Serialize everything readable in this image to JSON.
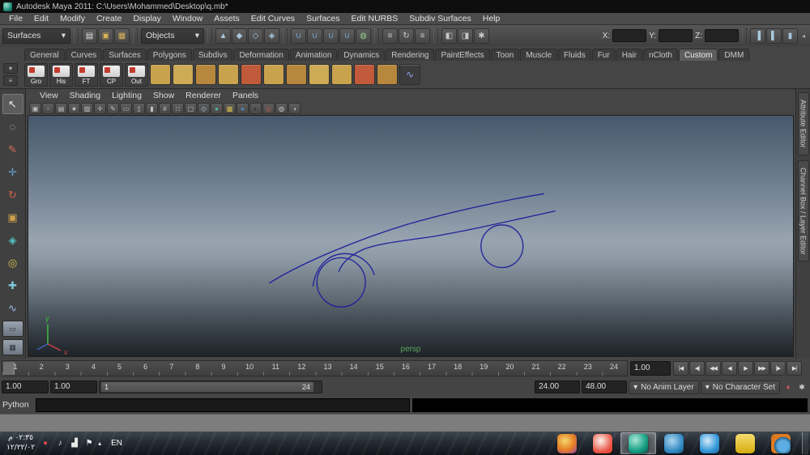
{
  "window": {
    "title": "Autodesk Maya 2011: C:\\Users\\Mohammed\\Desktop\\q.mb*"
  },
  "ui": {
    "dropdown_arrow": "▾",
    "up_arrow": "▴",
    "collapse_arrow": "◂"
  },
  "menubar": {
    "items": [
      {
        "name": "menu-file",
        "label": "File"
      },
      {
        "name": "menu-edit",
        "label": "Edit"
      },
      {
        "name": "menu-modify",
        "label": "Modify"
      },
      {
        "name": "menu-create",
        "label": "Create"
      },
      {
        "name": "menu-display",
        "label": "Display"
      },
      {
        "name": "menu-window",
        "label": "Window"
      },
      {
        "name": "menu-assets",
        "label": "Assets"
      },
      {
        "name": "menu-edit-curves",
        "label": "Edit Curves"
      },
      {
        "name": "menu-surfaces",
        "label": "Surfaces"
      },
      {
        "name": "menu-edit-nurbs",
        "label": "Edit NURBS"
      },
      {
        "name": "menu-subdiv-surfaces",
        "label": "Subdiv Surfaces"
      },
      {
        "name": "menu-help",
        "label": "Help"
      }
    ]
  },
  "statusline": {
    "menuset": "Surfaces",
    "selection_mask": "Objects",
    "x_label": "X:",
    "y_label": "Y:",
    "z_label": "Z:",
    "x_value": "",
    "y_value": "",
    "z_value": "",
    "file_icons": [
      {
        "name": "new-scene-icon",
        "glyph": "▤",
        "color": "#e2e2e2"
      },
      {
        "name": "open-scene-icon",
        "glyph": "▣",
        "color": "#d9b45a"
      },
      {
        "name": "save-scene-icon",
        "glyph": "▦",
        "color": "#d9b45a"
      }
    ],
    "selection_icons": [
      {
        "name": "select-by-hierarchy-icon",
        "glyph": "▲",
        "color": "#a9c6da"
      },
      {
        "name": "select-by-object-icon",
        "glyph": "◆",
        "color": "#a9c6da"
      },
      {
        "name": "select-by-component-icon",
        "glyph": "◇",
        "color": "#a9c6da"
      },
      {
        "name": "select-by-asset-icon",
        "glyph": "◈",
        "color": "#a9c6da"
      }
    ],
    "snap_icons": [
      {
        "name": "snap-to-grids-icon",
        "glyph": "∪",
        "color": "#74a9dd"
      },
      {
        "name": "snap-to-curves-icon",
        "glyph": "∪",
        "color": "#74a9dd"
      },
      {
        "name": "snap-to-points-icon",
        "glyph": "∪",
        "color": "#74a9dd"
      },
      {
        "name": "snap-to-view-planes-icon",
        "glyph": "∪",
        "color": "#74a9dd"
      },
      {
        "name": "make-live-icon",
        "glyph": "◍",
        "color": "#8fce8f"
      }
    ],
    "history_icons": [
      {
        "name": "input-to-selected-icon",
        "glyph": "≡",
        "color": "#cccccc"
      },
      {
        "name": "construction-history-icon",
        "glyph": "↻",
        "color": "#cccccc"
      },
      {
        "name": "output-from-selected-icon",
        "glyph": "≡",
        "color": "#cccccc"
      }
    ],
    "render_icons": [
      {
        "name": "render-current-frame-icon",
        "glyph": "◧",
        "color": "#c8c8c8"
      },
      {
        "name": "ipr-render-icon",
        "glyph": "◨",
        "color": "#c8c8c8"
      },
      {
        "name": "render-settings-icon",
        "glyph": "✱",
        "color": "#c8c8c8"
      }
    ],
    "sidebar_icons": [
      {
        "name": "show-attribute-editor-icon",
        "glyph": "▐",
        "color": "#a9c6da"
      },
      {
        "name": "show-tool-settings-icon",
        "glyph": "▌",
        "color": "#a9c6da"
      },
      {
        "name": "show-channel-box-icon",
        "glyph": "▮",
        "color": "#a9c6da"
      }
    ]
  },
  "shelf": {
    "side_buttons": [
      {
        "name": "shelf-tab-switcher-button",
        "glyph": "▾"
      },
      {
        "name": "shelf-menu-button",
        "glyph": "≡"
      }
    ],
    "tabs": [
      {
        "name": "shelf-tab-general",
        "label": "General"
      },
      {
        "name": "shelf-tab-curves",
        "label": "Curves"
      },
      {
        "name": "shelf-tab-surfaces",
        "label": "Surfaces"
      },
      {
        "name": "shelf-tab-polygons",
        "label": "Polygons"
      },
      {
        "name": "shelf-tab-subdivs",
        "label": "Subdivs"
      },
      {
        "name": "shelf-tab-deformation",
        "label": "Deformation"
      },
      {
        "name": "shelf-tab-animation",
        "label": "Animation"
      },
      {
        "name": "shelf-tab-dynamics",
        "label": "Dynamics"
      },
      {
        "name": "shelf-tab-rendering",
        "label": "Rendering"
      },
      {
        "name": "shelf-tab-painteffects",
        "label": "PaintEffects"
      },
      {
        "name": "shelf-tab-toon",
        "label": "Toon"
      },
      {
        "name": "shelf-tab-muscle",
        "label": "Muscle"
      },
      {
        "name": "shelf-tab-fluids",
        "label": "Fluids"
      },
      {
        "name": "shelf-tab-fur",
        "label": "Fur"
      },
      {
        "name": "shelf-tab-hair",
        "label": "Hair"
      },
      {
        "name": "shelf-tab-ncloth",
        "label": "nCloth"
      },
      {
        "name": "shelf-tab-custom",
        "label": "Custom",
        "active": true
      },
      {
        "name": "shelf-tab-dmm",
        "label": "DMM"
      }
    ],
    "labeled_items": [
      {
        "name": "shelf-item-gro",
        "label": "Gro"
      },
      {
        "name": "shelf-item-his",
        "label": "His"
      },
      {
        "name": "shelf-item-ft",
        "label": "FT"
      },
      {
        "name": "shelf-item-cp",
        "label": "CP"
      },
      {
        "name": "shelf-item-out",
        "label": "Out"
      }
    ],
    "icon_items": [
      {
        "name": "shelf-item-6",
        "bg": "#c9a24e"
      },
      {
        "name": "shelf-item-7",
        "bg": "#cdaa56"
      },
      {
        "name": "shelf-item-8",
        "bg": "#b8873e"
      },
      {
        "name": "shelf-item-9",
        "bg": "#c9a24e"
      },
      {
        "name": "shelf-item-10",
        "bg": "#c05a3a"
      },
      {
        "name": "shelf-item-11",
        "bg": "#c9a24e"
      },
      {
        "name": "shelf-item-12",
        "bg": "#b8873e"
      },
      {
        "name": "shelf-item-13",
        "bg": "#cdaa56"
      },
      {
        "name": "shelf-item-14",
        "bg": "#c9a24e"
      },
      {
        "name": "shelf-item-15",
        "bg": "#c05a3a"
      },
      {
        "name": "shelf-item-16",
        "bg": "#b8873e"
      },
      {
        "name": "shelf-item-17",
        "glyph": "∿",
        "color": "#8fa8e8",
        "bg": "#3c3c3c"
      }
    ]
  },
  "toolbox": {
    "tools": [
      {
        "name": "select-tool",
        "glyph": "↖",
        "color": "#e8e8e8",
        "active": true
      },
      {
        "name": "lasso-tool",
        "glyph": "◌",
        "color": "#e0b9b9"
      },
      {
        "name": "paint-selection-tool",
        "glyph": "✎",
        "color": "#d06a55"
      },
      {
        "name": "move-tool",
        "glyph": "✛",
        "color": "#6aa2d8"
      },
      {
        "name": "rotate-tool",
        "glyph": "↻",
        "color": "#d0604d"
      },
      {
        "name": "scale-tool",
        "glyph": "▣",
        "color": "#d0a24d"
      },
      {
        "name": "universal-manipulator-tool",
        "glyph": "◈",
        "color": "#54c2c2"
      },
      {
        "name": "soft-modification-tool",
        "glyph": "◎",
        "color": "#d8c455"
      },
      {
        "name": "show-manipulator-tool",
        "glyph": "✚",
        "color": "#7fc8d8"
      },
      {
        "name": "last-tool-used",
        "glyph": "∿",
        "color": "#9fb4e8"
      }
    ],
    "layout_buttons": [
      {
        "name": "single-pane-layout-button",
        "glyph": "▭"
      },
      {
        "name": "four-pane-layout-button",
        "glyph": "▦"
      }
    ]
  },
  "panel": {
    "menus": [
      {
        "name": "panel-menu-view",
        "label": "View"
      },
      {
        "name": "panel-menu-shading",
        "label": "Shading"
      },
      {
        "name": "panel-menu-lighting",
        "label": "Lighting"
      },
      {
        "name": "panel-menu-show",
        "label": "Show"
      },
      {
        "name": "panel-menu-renderer",
        "label": "Renderer"
      },
      {
        "name": "panel-menu-panels",
        "label": "Panels"
      }
    ],
    "toolbar_icons": [
      {
        "name": "select-camera-icon",
        "glyph": "▣"
      },
      {
        "name": "lock-camera-icon",
        "glyph": "▫"
      },
      {
        "name": "camera-attributes-icon",
        "glyph": "▤"
      },
      {
        "name": "bookmarks-icon",
        "glyph": "★"
      },
      {
        "name": "image-plane-icon",
        "glyph": "▧"
      },
      {
        "name": "two-d-pan-zoom-icon",
        "glyph": "✛"
      },
      {
        "name": "grease-pencil-icon",
        "glyph": "✎"
      },
      {
        "name": "film-gate-icon",
        "glyph": "▭"
      },
      {
        "name": "resolution-gate-icon",
        "glyph": "▯"
      },
      {
        "name": "gate-mask-icon",
        "glyph": "▮"
      },
      {
        "name": "field-chart-icon",
        "glyph": "#"
      },
      {
        "name": "safe-action-icon",
        "glyph": "□"
      },
      {
        "name": "safe-title-icon",
        "glyph": "▢"
      },
      {
        "name": "wireframe-mode-icon",
        "glyph": "◇",
        "color": "#bfe0ef"
      },
      {
        "name": "smooth-shade-icon",
        "glyph": "●",
        "color": "#4fb8a8"
      },
      {
        "name": "textured-mode-icon",
        "glyph": "▩",
        "color": "#d8c04a"
      },
      {
        "name": "use-all-lights-icon",
        "glyph": "●",
        "color": "#4f86c6"
      },
      {
        "name": "shadows-icon",
        "glyph": "◐",
        "color": "#2e2e2e"
      },
      {
        "name": "isolate-select-icon",
        "glyph": "◎",
        "color": "#c06050"
      },
      {
        "name": "xray-icon",
        "glyph": "◍"
      },
      {
        "name": "exposure-icon",
        "glyph": "◑"
      }
    ]
  },
  "viewport": {
    "camera_label": "persp",
    "label_color": "#58a858",
    "curve_color": "#20209a",
    "axis_y_label": "y",
    "axis_x_label": "x"
  },
  "sidebar": {
    "tabs": [
      {
        "name": "tab-attribute-editor",
        "label": "Attribute Editor"
      },
      {
        "name": "tab-channel-box-layer-editor",
        "label": "Channel Box / Layer Editor"
      }
    ]
  },
  "timeslider": {
    "frames": [
      "1",
      "2",
      "3",
      "4",
      "5",
      "6",
      "7",
      "8",
      "9",
      "10",
      "11",
      "12",
      "13",
      "14",
      "15",
      "16",
      "17",
      "18",
      "19",
      "20",
      "21",
      "22",
      "23",
      "24"
    ],
    "current": "1.00",
    "transport": [
      {
        "name": "go-to-start-button",
        "glyph": "|◀"
      },
      {
        "name": "step-back-one-key-button",
        "glyph": "◀|"
      },
      {
        "name": "step-back-one-frame-button",
        "glyph": "◀◀"
      },
      {
        "name": "play-backwards-button",
        "glyph": "◀"
      },
      {
        "name": "play-forwards-button",
        "glyph": "▶"
      },
      {
        "name": "step-forward-one-frame-button",
        "glyph": "▶▶"
      },
      {
        "name": "step-forward-one-key-button",
        "glyph": "|▶"
      },
      {
        "name": "go-to-end-button",
        "glyph": "▶|"
      }
    ]
  },
  "rangeslider": {
    "anim_start": "1.00",
    "playback_start": "1.00",
    "range_start": "1",
    "range_end": "24",
    "playback_end": "24.00",
    "anim_end": "48.00",
    "anim_layer": "No Anim Layer",
    "character_set": "No Character Set",
    "icons": [
      {
        "name": "auto-keyframe-icon",
        "glyph": "♦",
        "color": "#cc5555"
      },
      {
        "name": "animation-preferences-icon",
        "glyph": "✱",
        "color": "#cccccc"
      }
    ]
  },
  "commandline": {
    "label": "Python"
  },
  "helpline": {
    "text": ""
  },
  "taskbar": {
    "time": "٠٢:٣٥ م",
    "date": "١٢/٢٢/٠٢",
    "language": "EN",
    "tray": [
      {
        "name": "notification-icon",
        "glyph": "●",
        "color": "#d04545"
      },
      {
        "name": "volume-icon",
        "glyph": "♪",
        "color": "#e8e8e8"
      },
      {
        "name": "network-icon",
        "glyph": "▟",
        "color": "#e8e8e8"
      },
      {
        "name": "action-center-flag-icon",
        "glyph": "⚑",
        "color": "#e8e8e8"
      }
    ],
    "apps": [
      {
        "name": "taskbar-app-paint",
        "bg": "radial-gradient(circle at 40% 35%, #f5d76e, #e67e22 55%, #8e44ad)"
      },
      {
        "name": "taskbar-app-media",
        "bg": "radial-gradient(circle at 40% 35%, #fdf2e9, #e74c3c 70%)"
      },
      {
        "name": "taskbar-app-maya",
        "bg": "radial-gradient(circle at 35% 30%, #a8e6d5, #16a085 60%, #0b5345)",
        "active": true
      },
      {
        "name": "taskbar-app-windows",
        "bg": "radial-gradient(circle at 40% 35%, #aed6f1, #2e86c1 65%, #1b4f72)"
      },
      {
        "name": "taskbar-app-messenger",
        "bg": "radial-gradient(circle at 40% 35%, #d6eaf8, #3498db 60%, #21618c)"
      },
      {
        "name": "taskbar-app-explorer",
        "bg": "linear-gradient(#f7dc6f, #d4ac0d)"
      },
      {
        "name": "taskbar-app-firefox",
        "bg": "radial-gradient(circle at 62% 62%, #5dade2 0 32%, #21618c 52%, #e67e22 54%, #ca6f1e)"
      }
    ]
  }
}
